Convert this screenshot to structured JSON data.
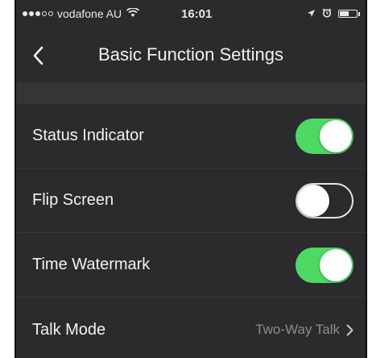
{
  "status_bar": {
    "carrier": "vodafone AU",
    "time": "16:01"
  },
  "nav": {
    "title": "Basic Function Settings"
  },
  "settings": [
    {
      "label": "Status Indicator",
      "type": "toggle",
      "on": true
    },
    {
      "label": "Flip Screen",
      "type": "toggle",
      "on": false
    },
    {
      "label": "Time Watermark",
      "type": "toggle",
      "on": true
    },
    {
      "label": "Talk Mode",
      "type": "value",
      "value": "Two-Way Talk"
    }
  ],
  "colors": {
    "background": "#2b2b2d",
    "toggle_on": "#4cd964"
  }
}
